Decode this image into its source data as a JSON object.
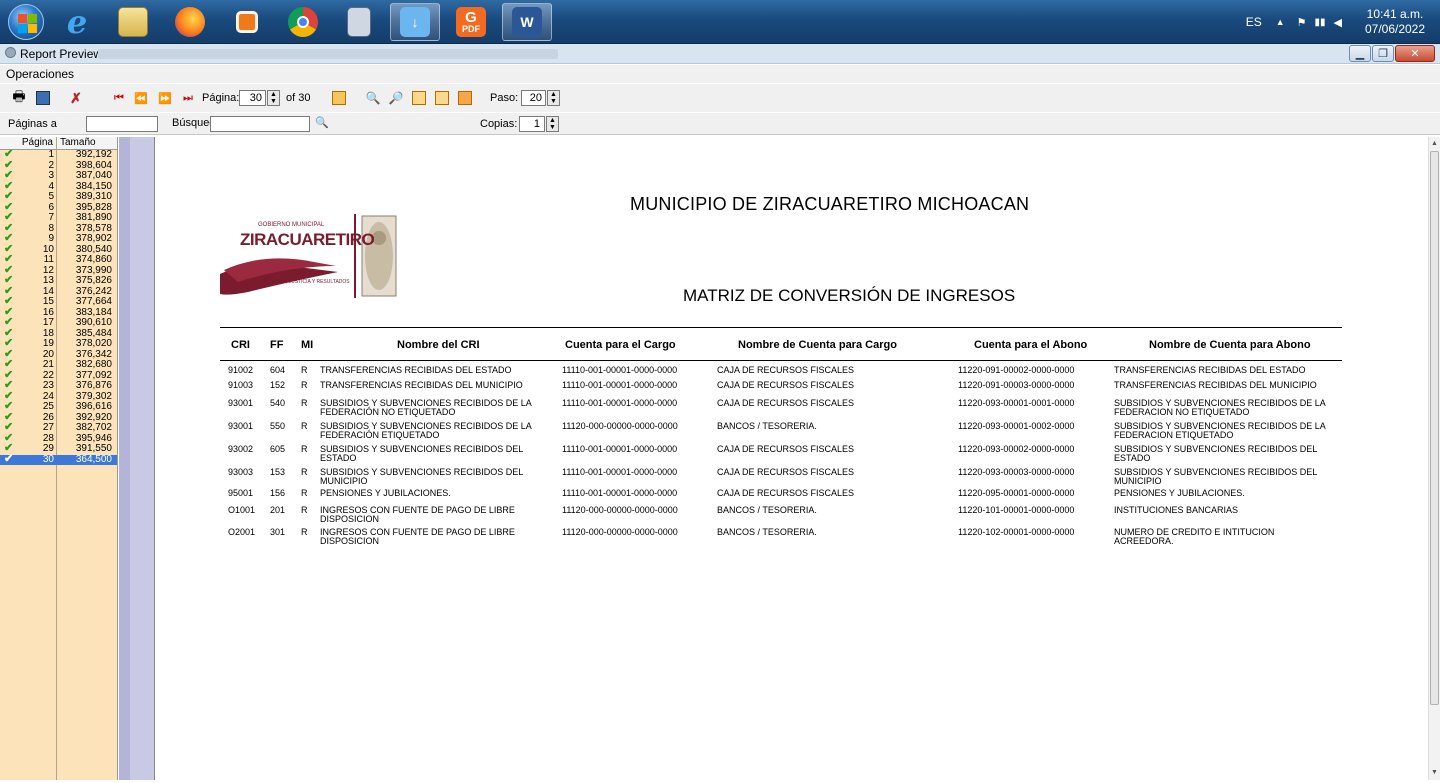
{
  "taskbar": {
    "tray_lang": "ES",
    "clock_time": "10:41 a.m.",
    "clock_date": "07/06/2022",
    "apps": [
      {
        "name": "internet-explorer-icon"
      },
      {
        "name": "file-explorer-icon"
      },
      {
        "name": "firefox-icon"
      },
      {
        "name": "app-orange-icon"
      },
      {
        "name": "chrome-icon"
      },
      {
        "name": "calculator-icon"
      },
      {
        "name": "download-icon"
      },
      {
        "name": "pdf-app-icon",
        "label": "PDF"
      },
      {
        "name": "word-icon",
        "label": "W"
      }
    ]
  },
  "window": {
    "title": "Report Preview"
  },
  "menu": {
    "operaciones": "Operaciones"
  },
  "toolbar": {
    "pagina_label": "Página:",
    "pagina_value": "30",
    "of_label": "of 30",
    "paso_label": "Paso:",
    "paso_value": "20"
  },
  "searchbar": {
    "paginas_label": "Páginas a",
    "busqueda_label": "Búsqueda",
    "copias_label": "Copias:",
    "copias_value": "1"
  },
  "pagelist": {
    "col_page": "Página",
    "col_size": "Tamaño",
    "rows": [
      {
        "n": "1",
        "s": "392,192"
      },
      {
        "n": "2",
        "s": "398,604"
      },
      {
        "n": "3",
        "s": "387,040"
      },
      {
        "n": "4",
        "s": "384,150"
      },
      {
        "n": "5",
        "s": "389,310"
      },
      {
        "n": "6",
        "s": "395,828"
      },
      {
        "n": "7",
        "s": "381,890"
      },
      {
        "n": "8",
        "s": "378,578"
      },
      {
        "n": "9",
        "s": "378,902"
      },
      {
        "n": "10",
        "s": "380,540"
      },
      {
        "n": "11",
        "s": "374,860"
      },
      {
        "n": "12",
        "s": "373,990"
      },
      {
        "n": "13",
        "s": "375,826"
      },
      {
        "n": "14",
        "s": "376,242"
      },
      {
        "n": "15",
        "s": "377,664"
      },
      {
        "n": "16",
        "s": "383,184"
      },
      {
        "n": "17",
        "s": "390,610"
      },
      {
        "n": "18",
        "s": "385,484"
      },
      {
        "n": "19",
        "s": "378,020"
      },
      {
        "n": "20",
        "s": "376,342"
      },
      {
        "n": "21",
        "s": "382,680"
      },
      {
        "n": "22",
        "s": "377,092"
      },
      {
        "n": "23",
        "s": "376,876"
      },
      {
        "n": "24",
        "s": "379,302"
      },
      {
        "n": "25",
        "s": "396,616"
      },
      {
        "n": "26",
        "s": "392,920"
      },
      {
        "n": "27",
        "s": "382,702"
      },
      {
        "n": "28",
        "s": "395,946"
      },
      {
        "n": "29",
        "s": "391,550"
      },
      {
        "n": "30",
        "s": "364,500"
      }
    ]
  },
  "report": {
    "municipio": "MUNICIPIO DE ZIRACUARETIRO MICHOACAN",
    "titulo": "MATRIZ DE CONVERSIÓN DE INGRESOS",
    "logo_small": "GOBIERNO MUNICIPAL",
    "logo_main": "ZIRACUARETIRO",
    "logo_sub": "SERVICIO, JUSTICIA Y RESULTADOS",
    "headers": {
      "cri": "CRI",
      "ff": "FF",
      "mi": "MI",
      "nombre_cri": "Nombre del CRI",
      "cuenta_cargo": "Cuenta para el Cargo",
      "nombre_cargo": "Nombre de Cuenta para Cargo",
      "cuenta_abono": "Cuenta para el Abono",
      "nombre_abono": "Nombre de Cuenta para Abono"
    },
    "rows": [
      {
        "cri": "91002",
        "ff": "604",
        "mi": "R",
        "nombre": [
          "TRANSFERENCIAS RECIBIDAS DEL ESTADO"
        ],
        "cargo": "11110-001-00001-0000-0000",
        "ncargo": "CAJA DE RECURSOS FISCALES",
        "abono": "11220-091-00002-0000-0000",
        "nabono": [
          "TRANSFERENCIAS RECIBIDAS DEL ESTADO"
        ]
      },
      {
        "cri": "91003",
        "ff": "152",
        "mi": "R",
        "nombre": [
          "TRANSFERENCIAS RECIBIDAS DEL MUNICIPIO"
        ],
        "cargo": "11110-001-00001-0000-0000",
        "ncargo": "CAJA DE RECURSOS FISCALES",
        "abono": "11220-091-00003-0000-0000",
        "nabono": [
          "TRANSFERENCIAS RECIBIDAS DEL MUNICIPIO"
        ]
      },
      {
        "cri": "93001",
        "ff": "540",
        "mi": "R",
        "nombre": [
          "SUBSIDIOS Y SUBVENCIONES RECIBIDOS DE LA",
          "FEDERACIÓN NO ETIQUETADO"
        ],
        "cargo": "11110-001-00001-0000-0000",
        "ncargo": "CAJA DE RECURSOS FISCALES",
        "abono": "11220-093-00001-0001-0000",
        "nabono": [
          "SUBSIDIOS Y SUBVENCIONES RECIBIDOS DE LA",
          "FEDERACION NO ETIQUETADO"
        ]
      },
      {
        "cri": "93001",
        "ff": "550",
        "mi": "R",
        "nombre": [
          "SUBSIDIOS Y SUBVENCIONES RECIBIDOS DE LA",
          "FEDERACIÓN ETIQUETADO"
        ],
        "cargo": "11120-000-00000-0000-0000",
        "ncargo": "BANCOS / TESORERIA.",
        "abono": "11220-093-00001-0002-0000",
        "nabono": [
          "SUBSIDIOS Y SUBVENCIONES RECIBIDOS DE LA",
          "FEDERACION ETIQUETADO"
        ]
      },
      {
        "cri": "93002",
        "ff": "605",
        "mi": "R",
        "nombre": [
          "SUBSIDIOS Y SUBVENCIONES RECIBIDOS DEL",
          "ESTADO"
        ],
        "cargo": "11110-001-00001-0000-0000",
        "ncargo": "CAJA DE RECURSOS FISCALES",
        "abono": "11220-093-00002-0000-0000",
        "nabono": [
          "SUBSIDIOS Y SUBVENCIONES RECIBIDOS DEL",
          "ESTADO"
        ]
      },
      {
        "cri": "93003",
        "ff": "153",
        "mi": "R",
        "nombre": [
          "SUBSIDIOS Y SUBVENCIONES RECIBIDOS DEL",
          "MUNICIPIO"
        ],
        "cargo": "11110-001-00001-0000-0000",
        "ncargo": "CAJA DE RECURSOS FISCALES",
        "abono": "11220-093-00003-0000-0000",
        "nabono": [
          "SUBSIDIOS Y SUBVENCIONES RECIBIDOS DEL",
          "MUNICIPIO"
        ]
      },
      {
        "cri": "95001",
        "ff": "156",
        "mi": "R",
        "nombre": [
          "PENSIONES Y JUBILACIONES."
        ],
        "cargo": "11110-001-00001-0000-0000",
        "ncargo": "CAJA DE RECURSOS FISCALES",
        "abono": "11220-095-00001-0000-0000",
        "nabono": [
          "PENSIONES Y JUBILACIONES."
        ]
      },
      {
        "cri": "O1001",
        "ff": "201",
        "mi": "R",
        "nombre": [
          "INGRESOS CON FUENTE DE PAGO DE LIBRE",
          "DISPOSICION"
        ],
        "cargo": "11120-000-00000-0000-0000",
        "ncargo": "BANCOS / TESORERIA.",
        "abono": "11220-101-00001-0000-0000",
        "nabono": [
          "INSTITUCIONES BANCARIAS"
        ]
      },
      {
        "cri": "O2001",
        "ff": "301",
        "mi": "R",
        "nombre": [
          "INGRESOS CON FUENTE DE PAGO DE LIBRE",
          "DISPOSICION"
        ],
        "cargo": "11120-000-00000-0000-0000",
        "ncargo": "BANCOS / TESORERIA.",
        "abono": "11220-102-00001-0000-0000",
        "nabono": [
          "NUMERO DE CREDITO E INTITUCION",
          "ACREEDORA."
        ]
      }
    ]
  }
}
